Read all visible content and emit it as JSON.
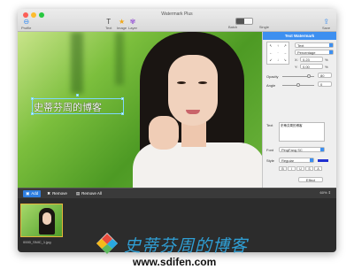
{
  "window": {
    "title": "Watermark Plus"
  },
  "toolbar": {
    "profile": "Profile",
    "text": "Text",
    "image": "Image",
    "layer": "Layer",
    "batch": "Batch",
    "single": "Single",
    "save": "Save"
  },
  "canvas": {
    "watermark_text": "史蒂芬周的博客"
  },
  "panel": {
    "header": "Text Watermark",
    "position_mode": "Text",
    "unit": "Percentage",
    "x_label": "X:",
    "x_value": "0.23",
    "y_label": "Y:",
    "y_value": "0.00",
    "unit_x": "%",
    "unit_y": "%",
    "opacity_label": "Opacity",
    "opacity_value": "80",
    "angle_label": "Angle",
    "angle_value": "0",
    "text_label": "Text",
    "text_value": "史蒂芬周的博客",
    "font_label": "Font",
    "font_value": "PingFang SC",
    "style_label": "Style",
    "style_value": "Regular",
    "format_buttons": [
      "B",
      "I",
      "U",
      "S",
      "A"
    ],
    "effect_label": "Effect"
  },
  "bottombar": {
    "add": "Add",
    "remove": "Remove",
    "remove_all": "Remove All",
    "zoom": "60%"
  },
  "thumbnail": {
    "filename": "0000_SNIC_1.jpg"
  },
  "site": {
    "name": "史蒂芬周的博客",
    "url": "www.sdifen.com"
  },
  "colors": {
    "accent": "#3d8ff0",
    "site_name": "#2f9fd5",
    "thumb_border": "#e7b53b"
  }
}
